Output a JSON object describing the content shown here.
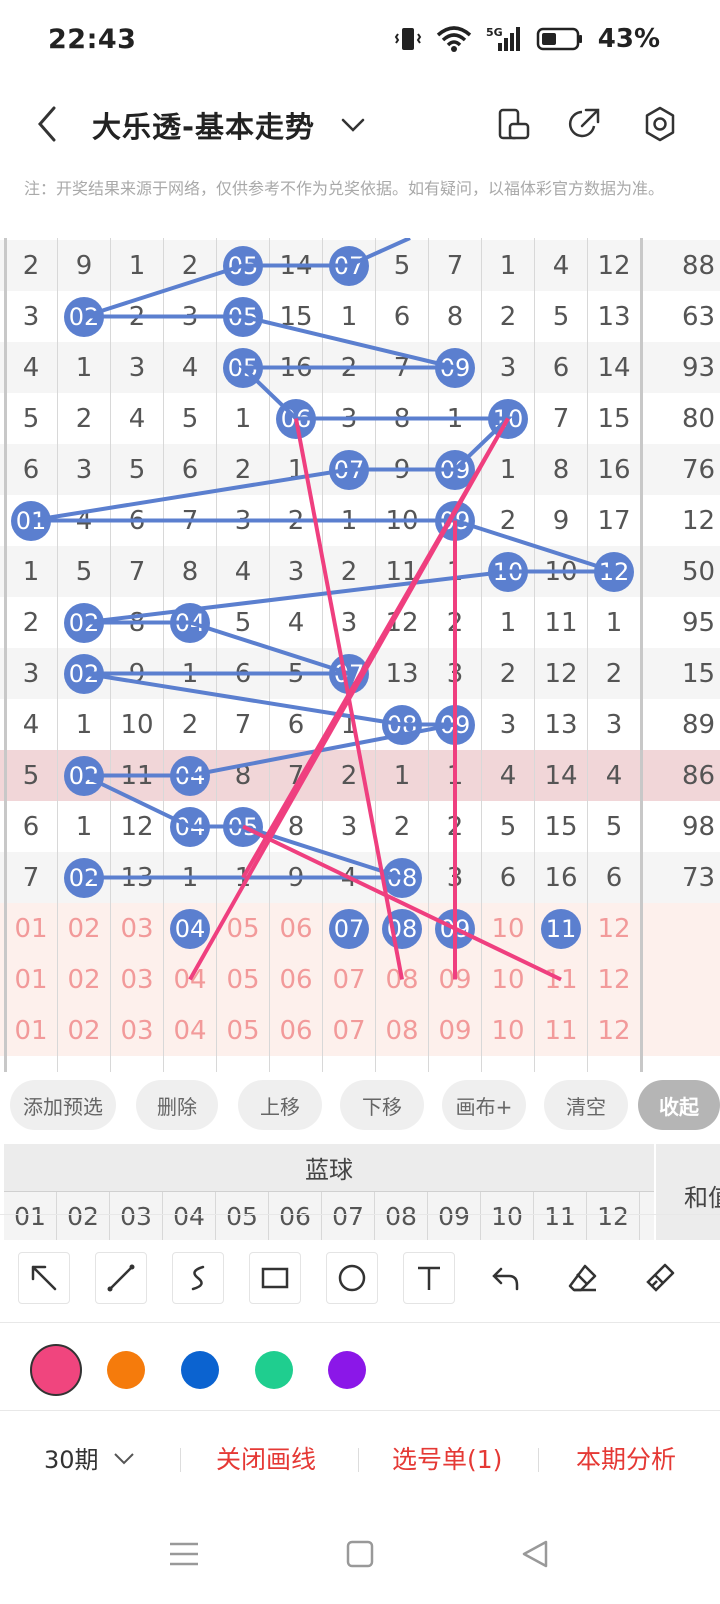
{
  "status": {
    "time": "22:43",
    "network": "5G",
    "battery": "43%"
  },
  "header": {
    "title": "大乐透-基本走势"
  },
  "notice": "注：开奖结果来源于网络，仅供参考不作为兑奖依据。如有疑问，以福体彩官方数据为准。",
  "chart_data": {
    "type": "table",
    "rows": [
      {
        "cells": [
          "2",
          "9",
          "1",
          "2",
          "05",
          "14",
          "07",
          "5",
          "7",
          "1",
          "4",
          "12"
        ],
        "sum": "88",
        "balls": [
          4,
          6
        ]
      },
      {
        "cells": [
          "3",
          "02",
          "2",
          "3",
          "05",
          "15",
          "1",
          "6",
          "8",
          "2",
          "5",
          "13"
        ],
        "sum": "63",
        "balls": [
          1,
          4
        ]
      },
      {
        "cells": [
          "4",
          "1",
          "3",
          "4",
          "05",
          "16",
          "2",
          "7",
          "09",
          "3",
          "6",
          "14"
        ],
        "sum": "93",
        "balls": [
          4,
          8
        ]
      },
      {
        "cells": [
          "5",
          "2",
          "4",
          "5",
          "1",
          "06",
          "3",
          "8",
          "1",
          "10",
          "7",
          "15"
        ],
        "sum": "80",
        "balls": [
          5,
          9
        ]
      },
      {
        "cells": [
          "6",
          "3",
          "5",
          "6",
          "2",
          "1",
          "07",
          "9",
          "09",
          "1",
          "8",
          "16"
        ],
        "sum": "76",
        "balls": [
          6,
          8
        ]
      },
      {
        "cells": [
          "01",
          "4",
          "6",
          "7",
          "3",
          "2",
          "1",
          "10",
          "09",
          "2",
          "9",
          "17"
        ],
        "sum": "12",
        "balls": [
          0,
          8
        ]
      },
      {
        "cells": [
          "1",
          "5",
          "7",
          "8",
          "4",
          "3",
          "2",
          "11",
          "1",
          "10",
          "10",
          "12"
        ],
        "sum": "50",
        "balls": [
          9,
          11
        ]
      },
      {
        "cells": [
          "2",
          "02",
          "8",
          "04",
          "5",
          "4",
          "3",
          "12",
          "2",
          "1",
          "11",
          "1"
        ],
        "sum": "95",
        "balls": [
          1,
          3
        ]
      },
      {
        "cells": [
          "3",
          "02",
          "9",
          "1",
          "6",
          "5",
          "07",
          "13",
          "3",
          "2",
          "12",
          "2"
        ],
        "sum": "15",
        "balls": [
          1,
          6
        ]
      },
      {
        "cells": [
          "4",
          "1",
          "10",
          "2",
          "7",
          "6",
          "1",
          "08",
          "09",
          "3",
          "13",
          "3"
        ],
        "sum": "89",
        "balls": [
          7,
          8
        ]
      },
      {
        "cells": [
          "5",
          "02",
          "11",
          "04",
          "8",
          "7",
          "2",
          "1",
          "1",
          "4",
          "14",
          "4"
        ],
        "sum": "86",
        "balls": [
          1,
          3
        ]
      },
      {
        "cells": [
          "6",
          "1",
          "12",
          "04",
          "05",
          "8",
          "3",
          "2",
          "2",
          "5",
          "15",
          "5"
        ],
        "sum": "98",
        "balls": [
          3,
          4
        ]
      },
      {
        "cells": [
          "7",
          "02",
          "13",
          "1",
          "1",
          "9",
          "4",
          "08",
          "3",
          "6",
          "16",
          "6"
        ],
        "sum": "73",
        "balls": [
          1,
          7
        ]
      },
      {
        "cells": [
          "01",
          "02",
          "03",
          "04",
          "05",
          "06",
          "07",
          "08",
          "09",
          "10",
          "11",
          "12"
        ],
        "sum": "",
        "balls": [
          3,
          6,
          7,
          8,
          10
        ]
      },
      {
        "cells": [
          "01",
          "02",
          "03",
          "04",
          "05",
          "06",
          "07",
          "08",
          "09",
          "10",
          "11",
          "12"
        ],
        "sum": "",
        "balls": []
      },
      {
        "cells": [
          "01",
          "02",
          "03",
          "04",
          "05",
          "06",
          "07",
          "08",
          "09",
          "10",
          "11",
          "12"
        ],
        "sum": "",
        "balls": []
      }
    ],
    "highlight_row": 10,
    "ball_color": "#5b7fcf",
    "draw_color": "#ef3f7f"
  },
  "chips": [
    "添加预选",
    "删除",
    "上移",
    "下移",
    "画布+",
    "清空",
    "收起"
  ],
  "blue_header": {
    "title": "蓝球",
    "numbers": [
      "01",
      "02",
      "03",
      "04",
      "05",
      "06",
      "07",
      "08",
      "09",
      "10",
      "11",
      "12"
    ],
    "sum_label": "和值"
  },
  "tools": [
    "arrow-tool",
    "line-tool",
    "curve-tool",
    "rectangle-tool",
    "circle-tool",
    "text-tool",
    "undo",
    "eraser",
    "clear-brush"
  ],
  "colors": [
    "#f0457e",
    "#f57b0c",
    "#0b63d0",
    "#1fce8f",
    "#8b17e8"
  ],
  "actions": {
    "period": "30期",
    "close_draw": "关闭画线",
    "pick_list": "选号单(1)",
    "analysis": "本期分析"
  }
}
